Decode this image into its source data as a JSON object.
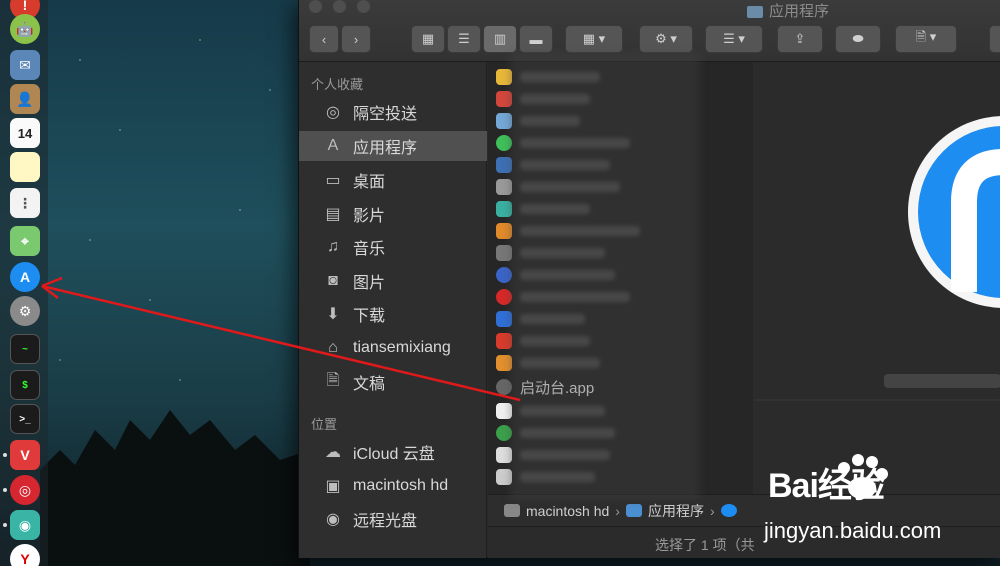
{
  "window": {
    "title": "应用程序"
  },
  "toolbar": {
    "back_icon": "chevron-left-icon",
    "forward_icon": "chevron-right-icon",
    "view_modes": [
      "icon-view",
      "list-view",
      "column-view",
      "gallery-view"
    ],
    "active_view": "column-view"
  },
  "sidebar": {
    "favorites_header": "个人收藏",
    "favorites": [
      {
        "label": "隔空投送",
        "icon": "airdrop-icon"
      },
      {
        "label": "应用程序",
        "icon": "applications-icon",
        "selected": true
      },
      {
        "label": "桌面",
        "icon": "desktop-icon"
      },
      {
        "label": "影片",
        "icon": "movies-icon"
      },
      {
        "label": "音乐",
        "icon": "music-icon"
      },
      {
        "label": "图片",
        "icon": "pictures-icon"
      },
      {
        "label": "下载",
        "icon": "downloads-icon"
      },
      {
        "label": "tiansemixiang",
        "icon": "home-icon"
      },
      {
        "label": "文稿",
        "icon": "documents-icon"
      }
    ],
    "locations_header": "位置",
    "locations": [
      {
        "label": "iCloud 云盘",
        "icon": "cloud-icon"
      },
      {
        "label": "macintosh hd",
        "icon": "disk-icon"
      },
      {
        "label": "远程光盘",
        "icon": "remote-disc-icon"
      }
    ]
  },
  "filelist": {
    "visible_item": "启动台.app"
  },
  "pathbar": {
    "items": [
      "macintosh hd",
      "应用程序"
    ]
  },
  "status": {
    "text": "选择了 1 项（共"
  },
  "watermark": {
    "logo": "Bai经验",
    "url": "jingyan.baidu.com"
  },
  "colors": {
    "window_bg": "#2b2b2b",
    "sidebar_selected": "#505050",
    "arrow": "#e0191b",
    "app_store_blue": "#1e8df1"
  }
}
